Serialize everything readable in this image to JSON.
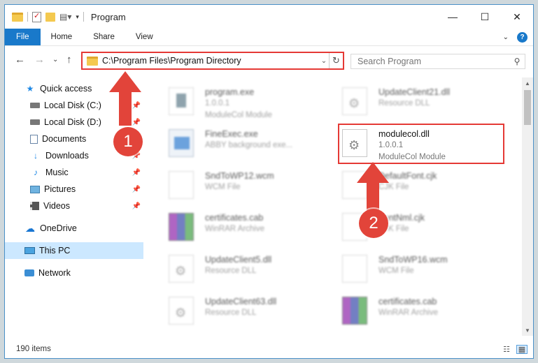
{
  "window": {
    "title": "Program",
    "minimize_glyph": "—",
    "maximize_glyph": "☐",
    "close_glyph": "✕"
  },
  "ribbon": {
    "tabs": [
      "File",
      "Home",
      "Share",
      "View"
    ],
    "help_glyph": "?",
    "expand_glyph": "⌄"
  },
  "address": {
    "back_glyph": "←",
    "forward_glyph": "→",
    "recent_glyph": "⌄",
    "up_glyph": "↑",
    "path": "C:\\Program Files\\Program Directory",
    "dropdown_glyph": "⌄",
    "refresh_glyph": "↻"
  },
  "search": {
    "placeholder": "Search Program",
    "icon_glyph": "⚲"
  },
  "nav": {
    "items": [
      {
        "label": "Quick access",
        "icon": "star-icon",
        "glyph": "★"
      },
      {
        "label": "Local Disk (C:)",
        "icon": "disk-icon",
        "pinned": true
      },
      {
        "label": "Local Disk (D:)",
        "icon": "disk-icon",
        "pinned": true
      },
      {
        "label": "Documents",
        "icon": "document-icon",
        "pinned": true
      },
      {
        "label": "Downloads",
        "icon": "download-icon",
        "glyph": "↓",
        "pinned": true
      },
      {
        "label": "Music",
        "icon": "music-icon",
        "glyph": "♪",
        "pinned": true
      },
      {
        "label": "Pictures",
        "icon": "pictures-icon",
        "pinned": true
      },
      {
        "label": "Videos",
        "icon": "videos-icon",
        "pinned": true
      },
      {
        "label": "OneDrive",
        "icon": "cloud-icon",
        "glyph": "☁"
      },
      {
        "label": "This PC",
        "icon": "pc-icon",
        "selected": true
      },
      {
        "label": "Network",
        "icon": "network-icon"
      }
    ],
    "pin_glyph": "📌"
  },
  "files": [
    {
      "name": "program.exe",
      "line1": "1.0.0.1",
      "line2": "ModuleCol Module",
      "type": "app"
    },
    {
      "name": "UpdateClient21.dll",
      "line1": "Resource DLL",
      "line2": "",
      "type": "dll"
    },
    {
      "name": "FineExec.exe",
      "line1": "ABBY background exe...",
      "line2": "",
      "type": "exe"
    },
    {
      "name": "modulecol.dll",
      "line1": "1.0.0.1",
      "line2": "ModuleCol Module",
      "type": "dll",
      "highlighted": true
    },
    {
      "name": "SndToWP12.wcm",
      "line1": "WCM File",
      "line2": "",
      "type": "page"
    },
    {
      "name": "DefaultFont.cjk",
      "line1": "CJK File",
      "line2": "",
      "type": "page"
    },
    {
      "name": "certificates.cab",
      "line1": "WinRAR Archive",
      "line2": "",
      "type": "rar"
    },
    {
      "name": "FontNml.cjk",
      "line1": "CJK File",
      "line2": "",
      "type": "page"
    },
    {
      "name": "UpdateClient5.dll",
      "line1": "Resource DLL",
      "line2": "",
      "type": "dll"
    },
    {
      "name": "SndToWP16.wcm",
      "line1": "WCM File",
      "line2": "",
      "type": "page"
    },
    {
      "name": "UpdateClient63.dll",
      "line1": "Resource DLL",
      "line2": "",
      "type": "dll"
    },
    {
      "name": "certificates.cab",
      "line1": "WinRAR Archive",
      "line2": "",
      "type": "rar"
    }
  ],
  "status": {
    "count": "190 items",
    "details_view_glyph": "☷",
    "tiles_view_glyph": "▦"
  },
  "annotations": {
    "badge1": "1",
    "badge2": "2",
    "color": "#e2443a"
  }
}
